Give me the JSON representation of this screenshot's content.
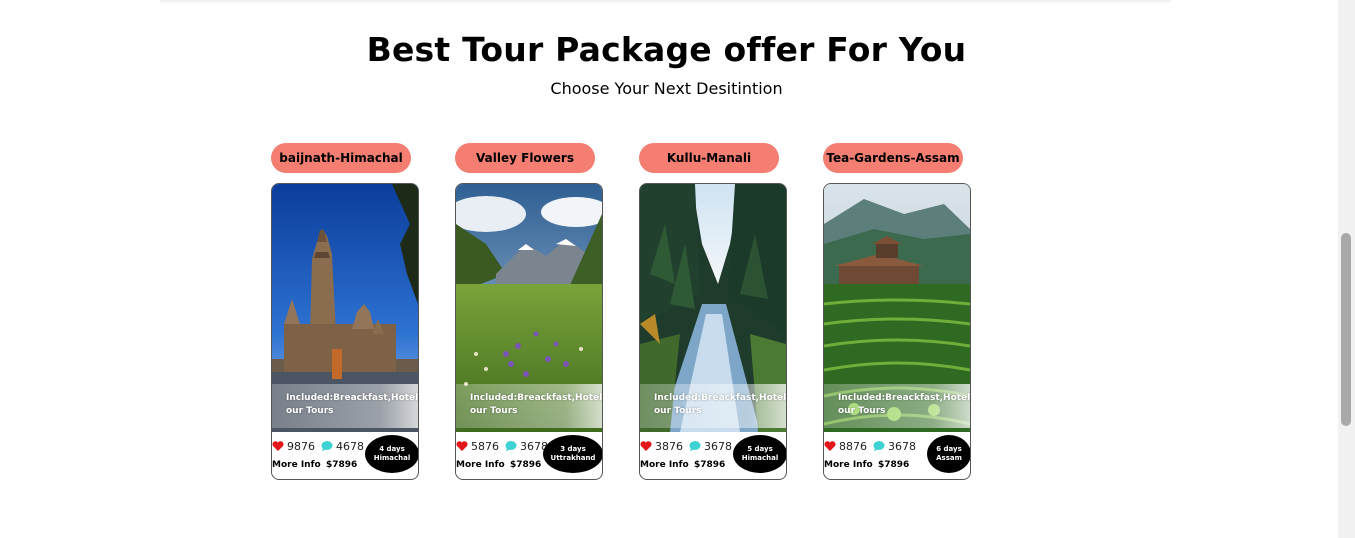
{
  "heading": {
    "title": "Best Tour Package offer For You",
    "subtitle": "Choose Your Next Desitintion"
  },
  "packages": [
    {
      "name": "baijnath-Himachal",
      "included": "Included:Breackfast,Hotel,tour Tours",
      "likes": "9876",
      "comments": "4678",
      "more_info": "More Info",
      "price": "$7896",
      "days": "4 days",
      "region": "Himachal",
      "image_icon": "temple-image"
    },
    {
      "name": "Valley Flowers",
      "included": "Included:Breackfast,Hotel,tour Tours",
      "likes": "5876",
      "comments": "3678",
      "more_info": "More Info",
      "price": "$7896",
      "days": "3 days",
      "region": "Uttrakhand",
      "image_icon": "flower-valley-image"
    },
    {
      "name": "Kullu-Manali",
      "included": "Included:Breackfast,Hotel,tour Tours",
      "likes": "3876",
      "comments": "3678",
      "more_info": "More Info",
      "price": "$7896",
      "days": "5 days",
      "region": "Himachal",
      "image_icon": "forest-river-image"
    },
    {
      "name": "Tea-Gardens-Assam",
      "included": "Included:Breackfast,Hotel,tour Tours",
      "likes": "8876",
      "comments": "3678",
      "more_info": "More Info",
      "price": "$7896",
      "days": "6 days",
      "region": "Assam",
      "image_icon": "tea-garden-image"
    }
  ],
  "colors": {
    "pill": "#f47e72",
    "heart": "#e3161c",
    "chat": "#3fd2d4",
    "badge": "#000000"
  }
}
